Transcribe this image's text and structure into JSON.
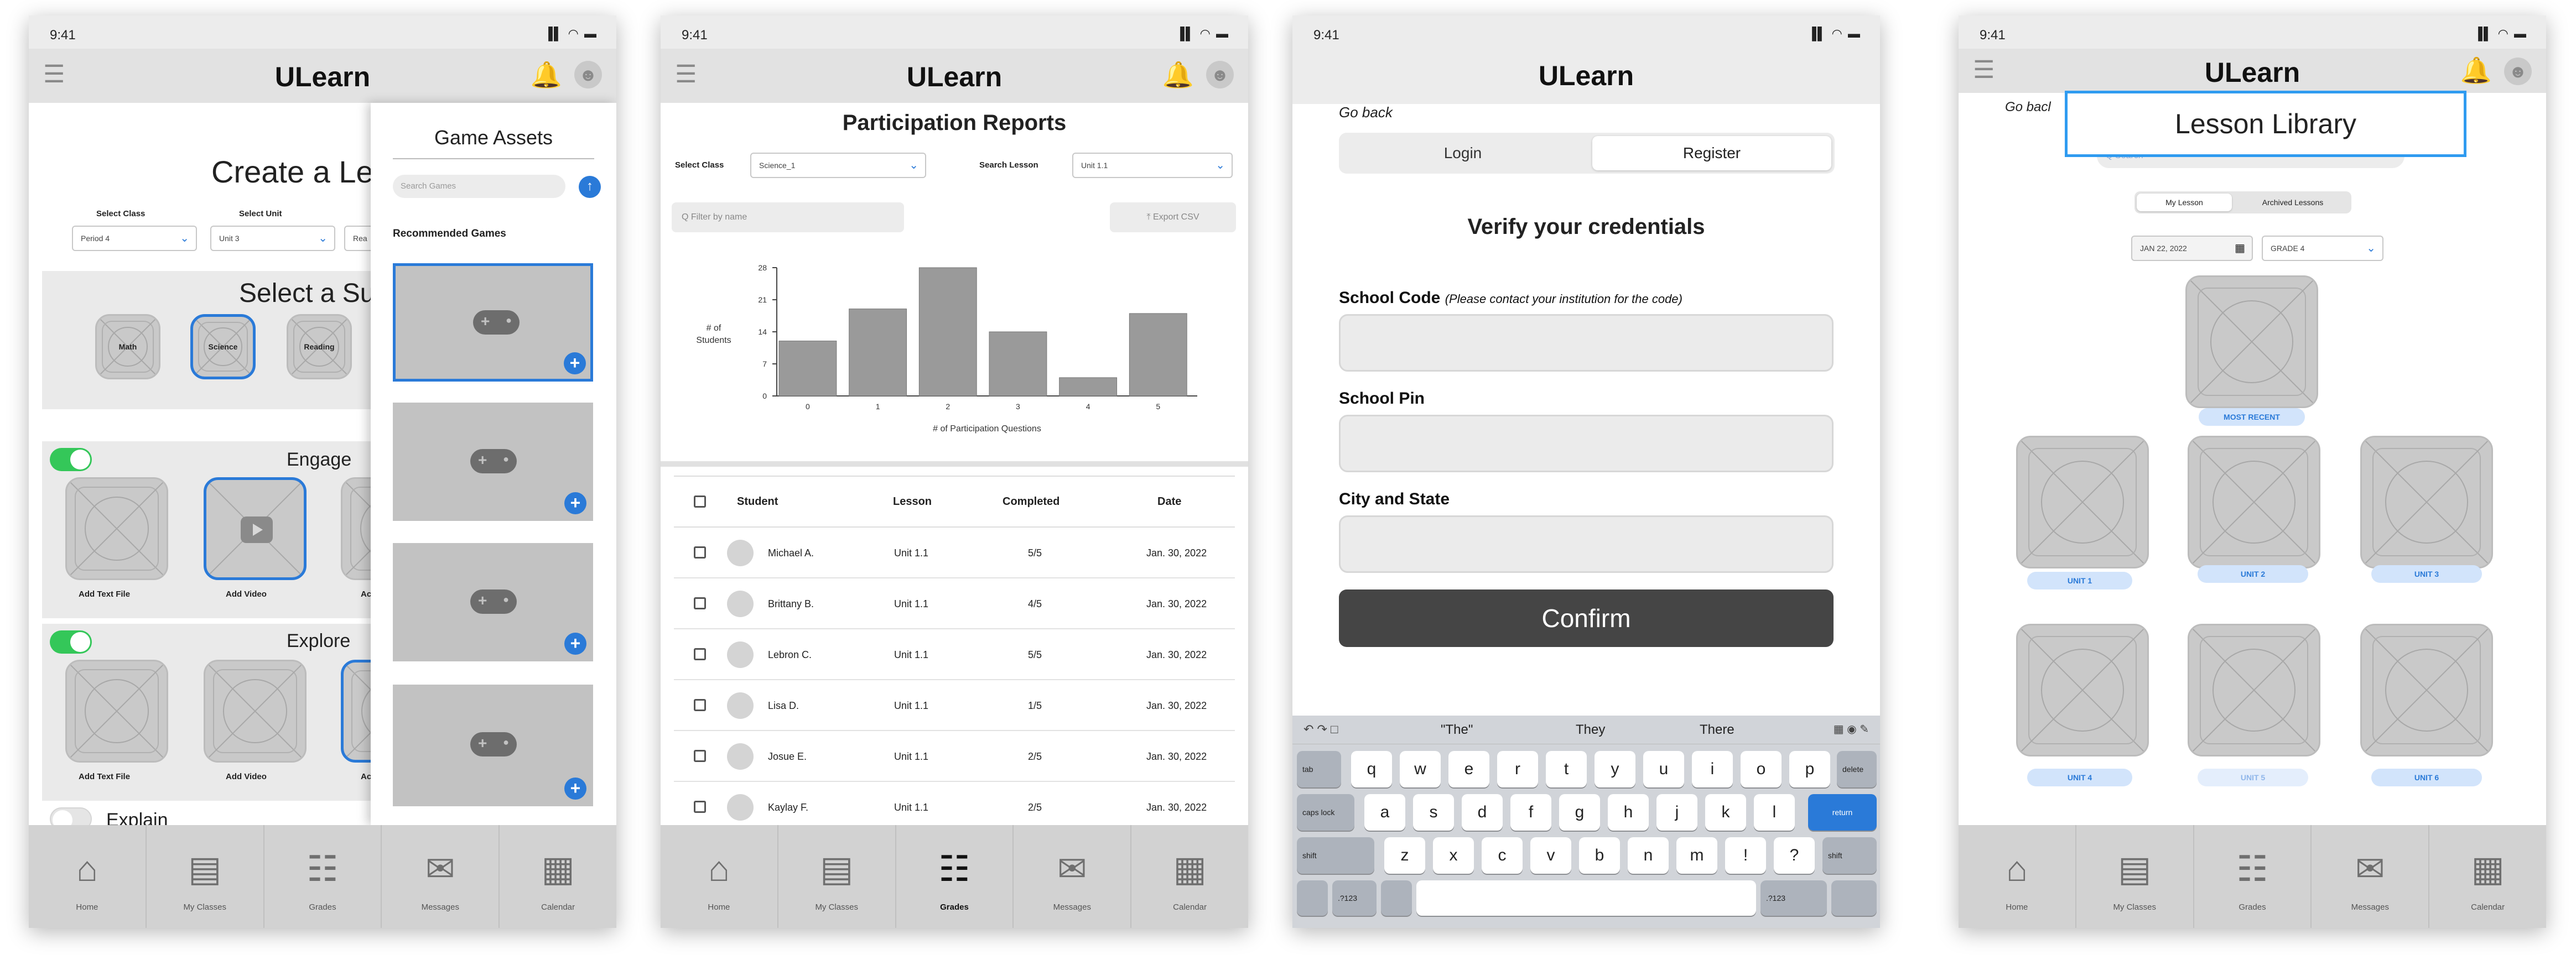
{
  "status": {
    "time": "9:41",
    "indicators": "▐▌ ◠ ▬"
  },
  "app_title": "ULearn",
  "tabs": [
    "Home",
    "My Classes",
    "Grades",
    "Messages",
    "Calendar"
  ],
  "icons": {
    "menu": "menu-icon",
    "bell": "bell-icon",
    "avatar": "avatar-icon",
    "home": "home-icon",
    "classes": "id-card-icon",
    "grades": "clipboard-icon",
    "messages": "envelope-icon",
    "calendar": "calendar-icon",
    "game": "gamepad-icon",
    "video": "play-icon"
  },
  "colors": {
    "accent": "#2a7ad8",
    "toggle_on": "#34c759",
    "confirm": "#454545",
    "highlight_border": "#2f9bf0"
  },
  "lesson_creator": {
    "heading": "Create a Les",
    "select_class_label": "Select Class",
    "select_class_value": "Period 4",
    "select_unit_label": "Select Unit",
    "select_unit_value": "Unit 3",
    "third_select_value": "Rea",
    "subject_heading": "Select a Sub",
    "subjects": [
      "Math",
      "Science",
      "Reading"
    ],
    "engage": {
      "title": "Engage",
      "items": [
        "Add Text File",
        "Add Video",
        "Ac"
      ]
    },
    "explore": {
      "title": "Explore",
      "items": [
        "Add Text File",
        "Add Video",
        "Ac"
      ]
    },
    "explain": {
      "title": "Explain"
    },
    "panel": {
      "title": "Game Assets",
      "search_placeholder": "Search Games",
      "recommended_label": "Recommended Games",
      "add_symbol": "+",
      "upload_symbol": "↑"
    }
  },
  "participation": {
    "title": "Participation Reports",
    "select_class_label": "Select Class",
    "select_class_value": "Science_1",
    "search_lesson_label": "Search Lesson",
    "search_lesson_value": "Unit 1.1",
    "filter_placeholder": "Q Filter by name",
    "export_label": "⤒ Export CSV",
    "table_headers": [
      "Student",
      "Lesson",
      "Completed",
      "Date"
    ],
    "rows": [
      {
        "student": "Michael A.",
        "lesson": "Unit 1.1",
        "completed": "5/5",
        "date": "Jan. 30, 2022"
      },
      {
        "student": "Brittany B.",
        "lesson": "Unit 1.1",
        "completed": "4/5",
        "date": "Jan. 30, 2022"
      },
      {
        "student": "Lebron C.",
        "lesson": "Unit 1.1",
        "completed": "5/5",
        "date": "Jan. 30, 2022"
      },
      {
        "student": "Lisa D.",
        "lesson": "Unit 1.1",
        "completed": "1/5",
        "date": "Jan. 30, 2022"
      },
      {
        "student": "Josue E.",
        "lesson": "Unit 1.1",
        "completed": "2/5",
        "date": "Jan. 30, 2022"
      },
      {
        "student": "Kaylay F.",
        "lesson": "Unit 1.1",
        "completed": "2/5",
        "date": "Jan. 30, 2022"
      }
    ]
  },
  "chart_data": {
    "type": "bar",
    "categories": [
      "0",
      "1",
      "2",
      "3",
      "4",
      "5"
    ],
    "values": [
      12,
      19,
      28,
      14,
      4,
      18
    ],
    "title": "",
    "xlabel": "# of Participation Questions",
    "ylabel": "# of Students",
    "yticks": [
      "28",
      "21",
      "14",
      "7",
      "0"
    ],
    "ylim": [
      0,
      28
    ],
    "bar_color": "#9a9a9a"
  },
  "register": {
    "go_back": "Go back",
    "tabs": [
      "Login",
      "Register"
    ],
    "heading": "Verify your credentials",
    "school_code_label": "School Code",
    "school_code_hint": "(Please contact your institution for the code)",
    "school_pin_label": "School Pin",
    "city_state_label": "City and State",
    "confirm_label": "Confirm",
    "suggestions": [
      "\"The\"",
      "They",
      "There"
    ],
    "keys_row1": [
      "q",
      "w",
      "e",
      "r",
      "t",
      "y",
      "u",
      "i",
      "o",
      "p"
    ],
    "keys_row2": [
      "a",
      "s",
      "d",
      "f",
      "g",
      "h",
      "j",
      "k",
      "l"
    ],
    "keys_row3": [
      "z",
      "x",
      "c",
      "v",
      "b",
      "n",
      "m",
      "!",
      "?"
    ],
    "key_tab": "tab",
    "key_delete": "delete",
    "key_caps": "caps lock",
    "key_return": "return",
    "key_shift": "shift",
    "key_123": ".?123"
  },
  "library": {
    "go_back": "Go bacl",
    "title": "Lesson Library",
    "search_placeholder": "Q Search",
    "toggle_tabs": [
      "My Lesson",
      "Archived Lessons"
    ],
    "date_value": "JAN 22, 2022",
    "grade_value": "GRADE 4",
    "most_recent_label": "MOST RECENT",
    "units": [
      "UNIT 1",
      "UNIT 2",
      "UNIT 3",
      "UNIT 4",
      "UNIT 5",
      "UNIT 6"
    ]
  }
}
